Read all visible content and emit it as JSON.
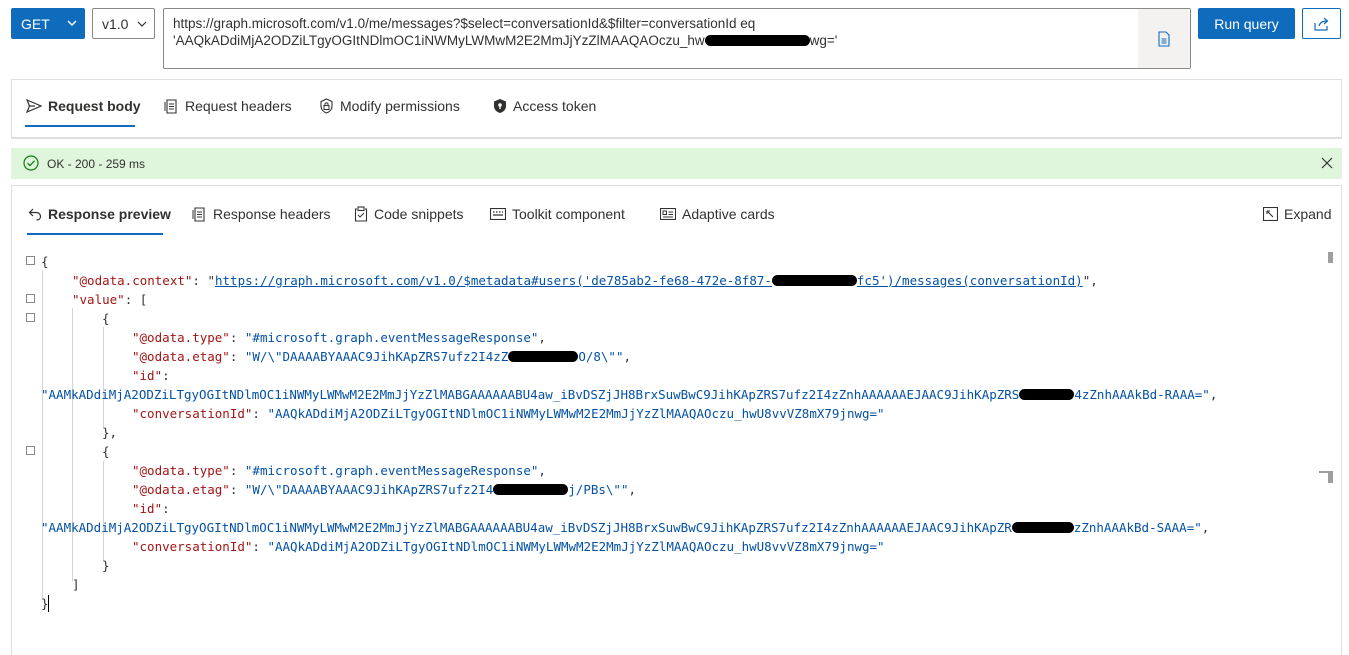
{
  "query": {
    "method": "GET",
    "version": "v1.0",
    "url_line1": "https://graph.microsoft.com/v1.0/me/messages?$select=conversationId&$filter=conversationId eq",
    "url_line2_a": "'AAQkADdiMjA2ODZiLTgyOGItNDlmOC1iNWMyLWMwM2E2MmJjYzZlMAAQAOczu_hw",
    "url_line2_b": "wg='",
    "run_label": "Run query"
  },
  "request_tabs": [
    {
      "label": "Request body",
      "icon": "send-icon"
    },
    {
      "label": "Request headers",
      "icon": "document-list-icon"
    },
    {
      "label": "Modify permissions",
      "icon": "lock-shield-icon"
    },
    {
      "label": "Access token",
      "icon": "shield-icon"
    }
  ],
  "status": {
    "text": "OK - 200 - 259 ms",
    "color": "#dff6dd"
  },
  "response_tabs": [
    {
      "label": "Response preview",
      "icon": "undo-arrow-icon"
    },
    {
      "label": "Response headers",
      "icon": "document-list-icon"
    },
    {
      "label": "Code snippets",
      "icon": "clipboard-icon"
    },
    {
      "label": "Toolkit component",
      "icon": "keyboard-icon"
    },
    {
      "label": "Adaptive cards",
      "icon": "card-icon"
    }
  ],
  "expand_label": "Expand",
  "json": {
    "open_brace": "{",
    "close_brace": "}",
    "odata_context_key": "\"@odata.context\"",
    "odata_context_val_a": "https://graph.microsoft.com/v1.0/$metadata#users('de785ab2-fe68-472e-8f87-",
    "odata_context_val_b": "fc5')/messages(conversationId)",
    "value_key": "\"value\"",
    "open_bracket": "[",
    "close_bracket": "]",
    "item_open": "{",
    "item_close_comma": "},",
    "item_close": "}",
    "odata_type_key": "\"@odata.type\"",
    "odata_type_val": "\"#microsoft.graph.eventMessageResponse\"",
    "odata_etag_key": "\"@odata.etag\"",
    "etag1_a": "\"W/\\\"DAAAABYAAAC9JihKApZRS7ufz2I4zZ",
    "etag1_b": "O/8\\\"\"",
    "etag2_a": "\"W/\\\"DAAAABYAAAC9JihKApZRS7ufz2I4",
    "etag2_b": "j/PBs\\\"\"",
    "id_key": "\"id\"",
    "id1_a": "\"AAMkADdiMjA2ODZiLTgyOGItNDlmOC1iNWMyLWMwM2E2MmJjYzZlMABGAAAAAABU4aw_iBvDSZjJH8BrxSuwBwC9JihKApZRS7ufz2I4zZnhAAAAAAEJAAC9JihKApZRS",
    "id1_b": "4zZnhAAAkBd-RAAA=\"",
    "id2_a": "\"AAMkADdiMjA2ODZiLTgyOGItNDlmOC1iNWMyLWMwM2E2MmJjYzZlMABGAAAAAABU4aw_iBvDSZjJH8BrxSuwBwC9JihKApZRS7ufz2I4zZnhAAAAAAEJAAC9JihKApZR",
    "id2_b": "zZnhAAAkBd-SAAA=\"",
    "conversation_key": "\"conversationId\"",
    "conversation_val": "\"AAQkADdiMjA2ODZiLTgyOGItNDlmOC1iNWMyLWMwM2E2MmJjYzZlMAAQAOczu_hwU8vvVZ8mX79jnwg=\""
  }
}
